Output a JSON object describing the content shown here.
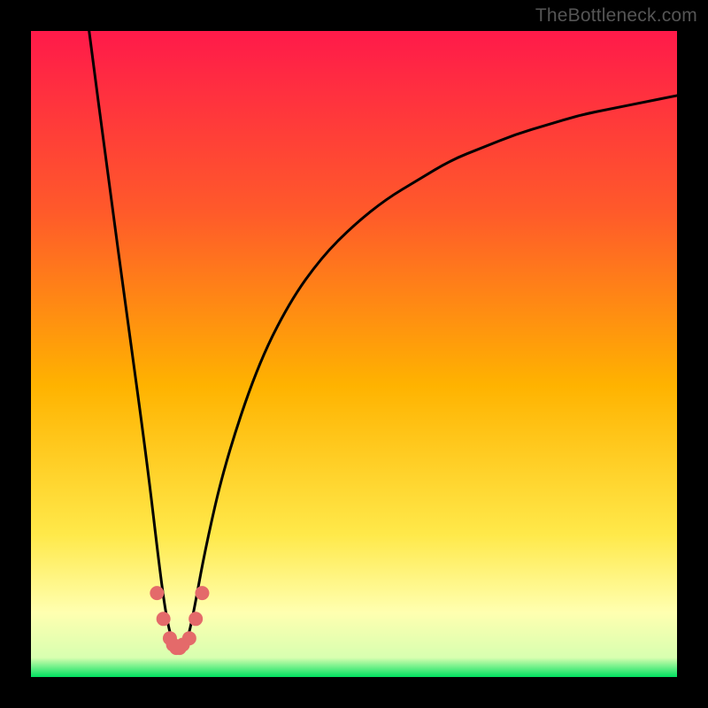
{
  "watermark": "TheBottleneck.com",
  "colors": {
    "frame": "#000000",
    "gradient_top": "#ff1a4a",
    "gradient_upper_mid": "#ff5a2a",
    "gradient_mid": "#ffb300",
    "gradient_lower_mid": "#ffe94a",
    "gradient_pale": "#ffffb0",
    "gradient_bottom": "#00e060",
    "curve": "#000000",
    "marker": "#e46a6a"
  },
  "chart_data": {
    "type": "line",
    "title": "",
    "xlabel": "",
    "ylabel": "",
    "xlim": [
      0,
      100
    ],
    "ylim": [
      0,
      100
    ],
    "series": [
      {
        "name": "bottleneck-curve",
        "x": [
          9,
          12,
          15,
          18,
          20,
          21,
          22,
          23,
          24,
          25,
          27,
          30,
          35,
          40,
          45,
          50,
          55,
          60,
          65,
          70,
          75,
          80,
          85,
          90,
          95,
          100
        ],
        "y": [
          100,
          77,
          55,
          33,
          16,
          9,
          5,
          4,
          5,
          9,
          20,
          33,
          48,
          58,
          65,
          70,
          74,
          77,
          80,
          82,
          84,
          85.5,
          87,
          88,
          89,
          90
        ]
      }
    ],
    "markers": {
      "name": "optimum-cluster",
      "x": [
        19.5,
        20.5,
        21.5,
        22.0,
        22.5,
        23.0,
        23.5,
        24.5,
        25.5,
        26.5
      ],
      "y": [
        13,
        9,
        6,
        5,
        4.5,
        4.5,
        5,
        6,
        9,
        13
      ]
    },
    "background_gradient_stops": [
      {
        "pos": 0.0,
        "color": "#ff1a4a"
      },
      {
        "pos": 0.28,
        "color": "#ff5a2a"
      },
      {
        "pos": 0.55,
        "color": "#ffb300"
      },
      {
        "pos": 0.78,
        "color": "#ffe94a"
      },
      {
        "pos": 0.9,
        "color": "#ffffb0"
      },
      {
        "pos": 0.97,
        "color": "#d8ffb0"
      },
      {
        "pos": 1.0,
        "color": "#00e060"
      }
    ]
  }
}
